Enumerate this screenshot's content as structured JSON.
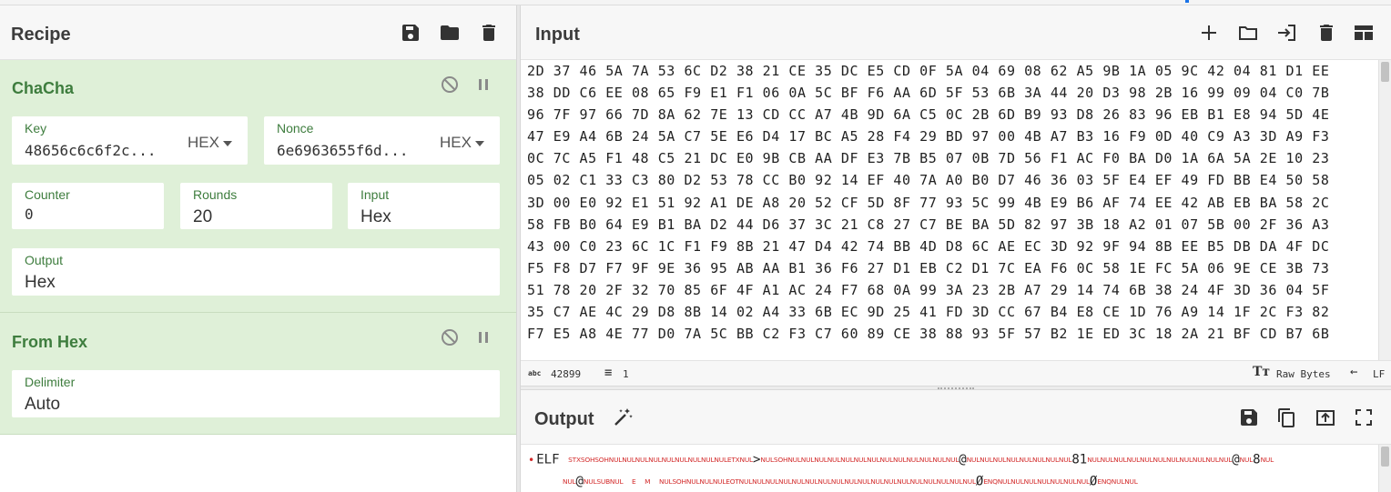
{
  "recipe": {
    "title": "Recipe",
    "ops": [
      {
        "name": "ChaCha",
        "key": {
          "label": "Key",
          "value": "48656c6c6f2c...",
          "format": "HEX"
        },
        "nonce": {
          "label": "Nonce",
          "value": "6e6963655f6d...",
          "format": "HEX"
        },
        "counter": {
          "label": "Counter",
          "value": "0"
        },
        "rounds": {
          "label": "Rounds",
          "value": "20"
        },
        "input": {
          "label": "Input",
          "value": "Hex"
        },
        "output": {
          "label": "Output",
          "value": "Hex"
        }
      },
      {
        "name": "From Hex",
        "delimiter": {
          "label": "Delimiter",
          "value": "Auto"
        }
      }
    ]
  },
  "input": {
    "title": "Input",
    "lines": [
      "2D 37 46 5A 7A 53 6C D2 38 21 CE 35 DC E5 CD 0F 5A 04 69 08 62 A5 9B 1A 05 9C 42 04 81 D1 EE",
      "38 DD C6 EE 08 65 F9 E1 F1 06 0A 5C BF F6 AA 6D 5F 53 6B 3A 44 20 D3 98 2B 16 99 09 04 C0 7B",
      "96 7F 97 66 7D 8A 62 7E 13 CD CC A7 4B 9D 6A C5 0C 2B 6D B9 93 D8 26 83 96 EB B1 E8 94 5D 4E",
      "47 E9 A4 6B 24 5A C7 5E E6 D4 17 BC A5 28 F4 29 BD 97 00 4B A7 B3 16 F9 0D 40 C9 A3 3D A9 F3",
      "0C 7C A5 F1 48 C5 21 DC E0 9B CB AA DF E3 7B B5 07 0B 7D 56 F1 AC F0 BA D0 1A 6A 5A 2E 10 23",
      "05 02 C1 33 C3 80 D2 53 78 CC B0 92 14 EF 40 7A A0 B0 D7 46 36 03 5F E4 EF 49 FD BB E4 50 58",
      "3D 00 E0 92 E1 51 92 A1 DE A8 20 52 CF 5D 8F 77 93 5C 99 4B E9 B6 AF 74 EE 42 AB EB BA 58 2C",
      "58 FB B0 64 E9 B1 BA D2 44 D6 37 3C 21 C8 27 C7 BE BA 5D 82 97 3B 18 A2 01 07 5B 00 2F 36 A3",
      "43 00 C0 23 6C 1C F1 F9 8B 21 47 D4 42 74 BB 4D D8 6C AE EC 3D 92 9F 94 8B EE B5 DB DA 4F DC",
      "F5 F8 D7 F7 9F 9E 36 95 AB AA B1 36 F6 27 D1 EB C2 D1 7C EA F6 0C 58 1E FC 5A 06 9E CE 3B 73",
      "51 78 20 2F 32 70 85 6F 4F A1 AC 24 F7 68 0A 99 3A 23 2B A7 29 14 74 6B 38 24 4F 3D 36 04 5F",
      "35 C7 AE 4C 29 D8 8B 14 02 A4 33 6B EC 9D 25 41 FD 3D CC 67 B4 E8 CE 1D 76 A9 14 1F 2C F3 82",
      "F7 E5 A8 4E 77 D0 7A 5C BB C2 F3 C7 60 89 CE 38 88 93 5F 57 B2 1E ED 3C 18 2A 21 BF CD B7 6B"
    ],
    "status": {
      "abc_label": "abc",
      "length": "42899",
      "lines": "1",
      "encoding": "Raw Bytes",
      "eol": "LF"
    }
  },
  "output": {
    "title": "Output",
    "line1": {
      "lead": "ELF",
      "a": "STXSOHSOHNULNULNULNULNULNULNULNULNULETXNUL",
      "b": ">",
      "c": "NULSOHNULNULNULNULNULNULNULNULNULNULNULNULNUL",
      "d": "@",
      "e": "NULNULNULNULNULNULNULNUL",
      "f": "81",
      "g": "NULNULNULNULNULNULNULNULNULNULNUL",
      "h": "@",
      "i": "NUL",
      "j": "8",
      "k": "NUL"
    },
    "line2": {
      "a": "NUL",
      "b": "@",
      "c": "NULSUBNUL",
      "d": "E",
      "e": "M",
      "f": "NULSOHNULNULNULEOTNULNULNULNULNULNULNULNULNULNULNULNULNULNULNULNULNULNUL",
      "g": "Ø",
      "h": "ENQNULNULNULNULNULNULNUL",
      "i": "Ø",
      "j": "ENQNULNUL"
    }
  },
  "colors": {
    "op_bg": "#dff0d8",
    "op_title": "#3e7d3e",
    "control_char": "#d32a2a"
  }
}
